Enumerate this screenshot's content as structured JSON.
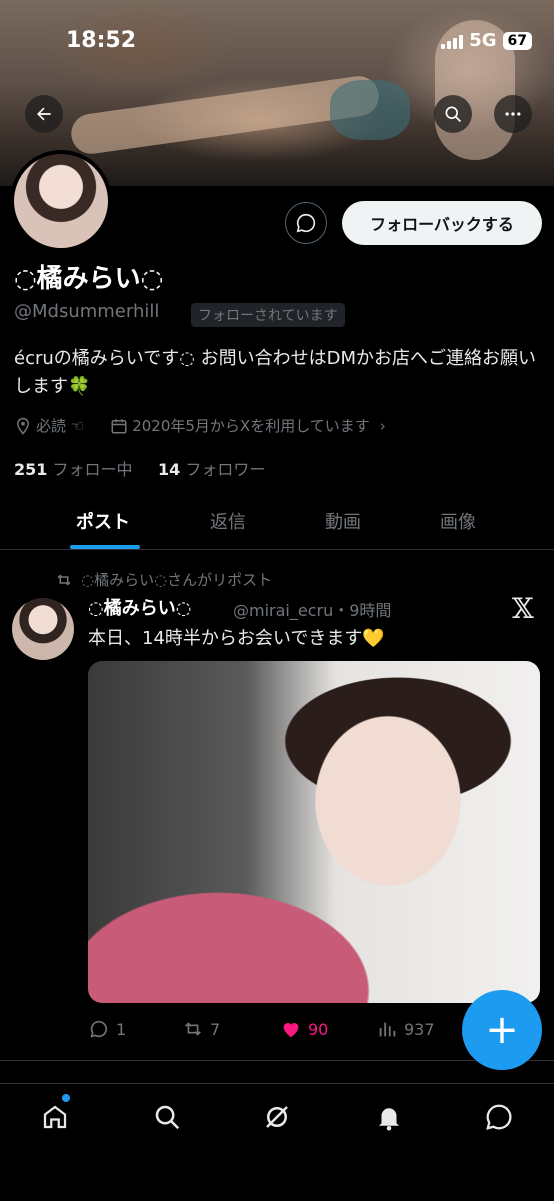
{
  "status": {
    "time": "18:52",
    "network": "5G",
    "battery": "67"
  },
  "profile": {
    "name": "◌橘みらい◌",
    "handle": "@Mdsummerhill",
    "follows_you": "フォローされています",
    "follow_back_label": "フォローバックする",
    "bio": "écruの橘みらいです◌ お問い合わせはDMかお店へご連絡お願いします🍀",
    "location": "必読 ☜",
    "joined": "2020年5月からXを利用しています",
    "following_count": "251",
    "following_label": "フォロー中",
    "followers_count": "14",
    "followers_label": "フォロワー"
  },
  "tabs": [
    {
      "label": "ポスト",
      "active": true
    },
    {
      "label": "返信",
      "active": false
    },
    {
      "label": "動画",
      "active": false
    },
    {
      "label": "画像",
      "active": false
    }
  ],
  "post": {
    "repost_by": "◌橘みらい◌さんがリポスト",
    "author_name": "◌橘みらい◌",
    "author_meta": "@mirai_ecru・9時間",
    "x_logo": "𝕏",
    "text": "本日、14時半からお会いできます💛",
    "replies": "1",
    "reposts": "7",
    "likes": "90",
    "views": "937"
  },
  "fab_label": "+",
  "colors": {
    "accent": "#1d9bf0",
    "like": "#f91880",
    "muted": "#71767b"
  }
}
